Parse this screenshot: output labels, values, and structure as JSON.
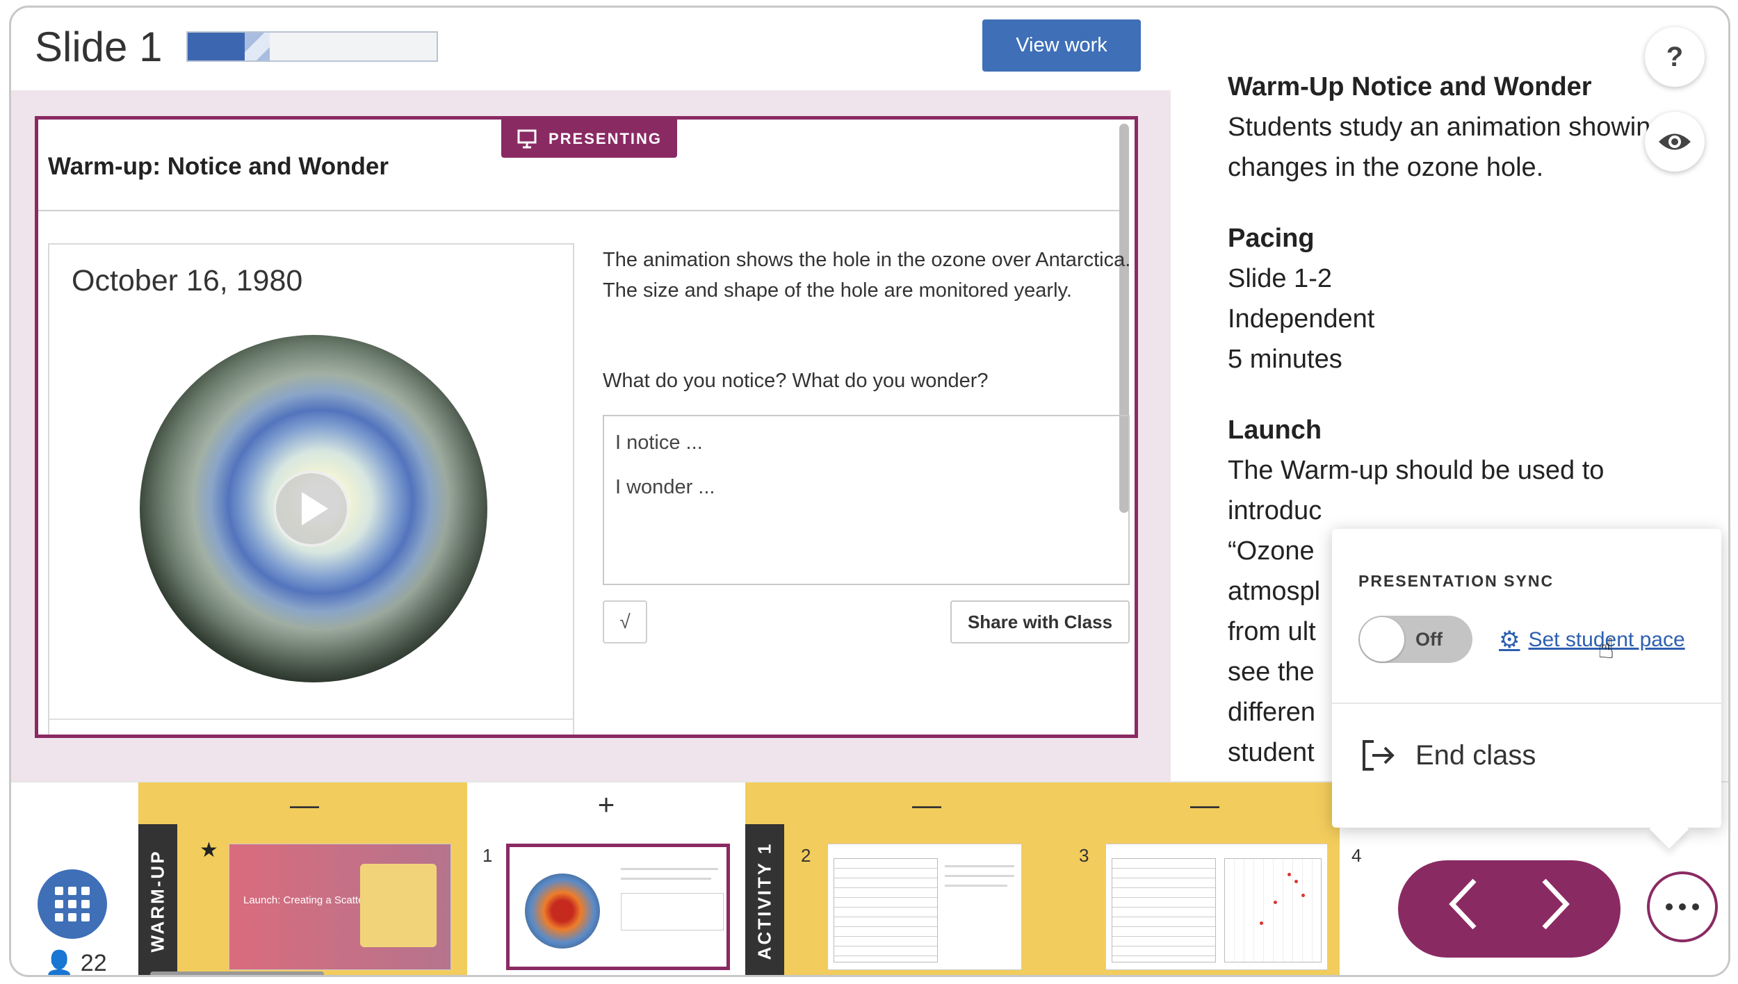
{
  "header": {
    "slide_title": "Slide 1",
    "progress_complete": 0.23,
    "progress_in_progress": 0.33,
    "view_work_label": "View work"
  },
  "slide": {
    "presenting_badge": "PRESENTING",
    "title": "Warm-up: Notice and Wonder",
    "media_date": "October 16, 1980",
    "prompt_text": "The animation shows the hole in the ozone over Antarctica. The size and shape of the hole are monitored yearly.",
    "question": "What do you notice? What do you wonder?",
    "answer_line1": "I notice ...",
    "answer_line2": "I wonder ...",
    "math_button": "√",
    "share_label": "Share with Class"
  },
  "notes": {
    "warmup_heading": "Warm-Up Notice and Wonder",
    "warmup_body": "Students study an animation showing changes in the ozone hole.",
    "pacing_heading": "Pacing",
    "pacing_lines": [
      "Slide 1-2",
      "Independent",
      "5 minutes"
    ],
    "launch_heading": "Launch",
    "launch_lines": [
      "The Warm-up should be used to",
      "introduc",
      "“Ozone",
      "atmospl",
      "from ult",
      "see the",
      "differen",
      "student"
    ]
  },
  "side_buttons": {
    "help": "?",
    "preview_icon": "eye-icon"
  },
  "popover": {
    "heading": "PRESENTATION SYNC",
    "toggle_label": "Off",
    "pace_link": "Set student pace",
    "end_class": "End class"
  },
  "filmstrip": {
    "student_count": "22",
    "warmup_label": "WARM-UP",
    "activity_label": "ACTIVITY 1",
    "collapse_symbol": "—",
    "expand_symbol": "+",
    "launch_thumb_text": "Launch: Creating a Scatter Plot",
    "slide_numbers": [
      "1",
      "2",
      "3",
      "4"
    ],
    "star": "★"
  },
  "colors": {
    "accent": "#8a2a63",
    "primary_blue": "#3e6fb7",
    "section_yellow": "#f2cc5c",
    "stage_bg": "#efe4ec"
  }
}
